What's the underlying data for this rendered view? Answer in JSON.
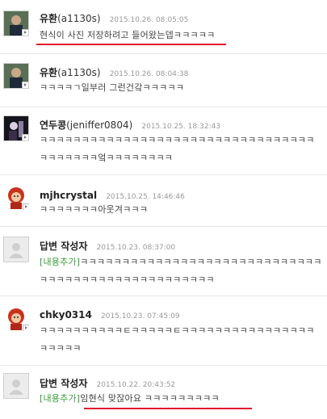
{
  "comments": [
    {
      "author": "유환",
      "author_id": "(a1130s)",
      "date": "2015.10.26. 08:05:05",
      "text": "현식이 사진 저장하려고 들어왔는뎁ㅋㅋㅋㅋㅋ",
      "avatar": "boy-photo"
    },
    {
      "author": "유환",
      "author_id": "(a1130s)",
      "date": "2015.10.26. 08:04:38",
      "text": "ㅋㅋㅋㅋㄱ일부러 그런건갘ㅋㅋㅋㅋㅋ",
      "avatar": "boy-photo"
    },
    {
      "author": "연두콩",
      "author_id": "(jeniffer0804)",
      "date": "2015.10.25. 18:32:43",
      "text": "ㅋㅋㅋㅋㅋㅋㅋㅋㅋㅋㅋㅋㅋㅋㅋㅋㅋㅋㅋㅋㅋㅋㅋㅋㅋㅋㅋㅋㅋㅋㅋㅋㅋㅋㅋㅋㅋㅋㅋㅋ엌ㅋㅋㅋㅋㅋㅋㅋㅋ",
      "avatar": "dark-photo"
    },
    {
      "author": "mjhcrystal",
      "author_id": "",
      "date": "2015.10.25. 14:46:46",
      "text": "ㅋㅋㅋㅋㅋㅋㅋ아웃겨ㅋㅋㅋ",
      "avatar": "cartoon-red"
    },
    {
      "author": "답변 작성자",
      "author_id": "",
      "date": "2015.10.23. 08:37:00",
      "tag": "[내용추가]",
      "text": "ㅋㅋㅋㅋㅋㅋㅋㅋㅋㅋㅋㅋㅋㅋㅋㅋㅋㅋㅋㅋㅋㅋㅋㅋㅋㅋㅋㅋㅋㅋㅋㅋㅋㅋㅋㅋㅋㅋㅋㅋㅋㅋㅋㅋㅋㅋㅋㅋㅋㅋ",
      "avatar": "default-user"
    },
    {
      "author": "chky0314",
      "author_id": "",
      "date": "2015.10.23. 07:45:09",
      "text": "ㅋㅋㅋㅋㅋㅋㅋㅋㅋㅋㅌㅋㅋㅋㅋㅋㅌㅋㅋㅋㅋㅋㅋㅋㅋㅋㅋㅋㅋㅋㅋㅋㅋㅋㅋㅋㅋㅋ",
      "avatar": "cartoon-red"
    },
    {
      "author": "답변 작성자",
      "author_id": "",
      "date": "2015.10.22. 20:43:52",
      "tag": "[내용추가]",
      "text": "임현식 맞잖아요 ㅋㅋㅋㅋㅋㅋㅋㅋㅋ",
      "avatar": "default-user"
    }
  ],
  "colors": {
    "underline": "#e2142e",
    "tag": "#3a9a3a",
    "date": "#9a9a9a"
  }
}
